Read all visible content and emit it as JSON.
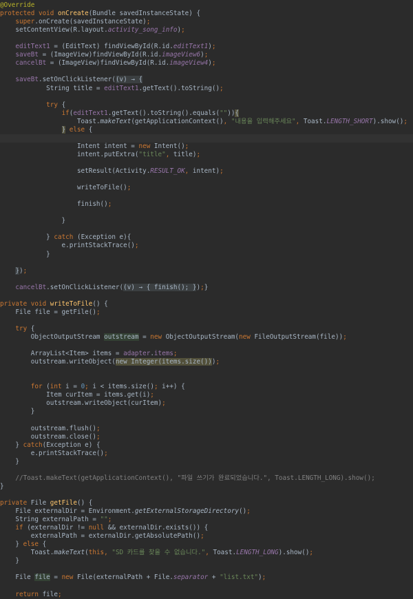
{
  "editor": {
    "language": "java",
    "lines": [
      [
        [
          "ann",
          "@Override"
        ]
      ],
      [
        [
          "kw",
          "protected void "
        ],
        [
          "fn",
          "onCreate"
        ],
        [
          "p",
          "(Bundle savedInstanceState) {"
        ]
      ],
      [
        [
          "p",
          "    "
        ],
        [
          "kw",
          "super"
        ],
        [
          "p",
          ".onCreate(savedInstanceState)"
        ],
        [
          "kw",
          ";"
        ]
      ],
      [
        [
          "p",
          "    setContentView(R.layout."
        ],
        [
          "fldi",
          "activity_song_info"
        ],
        [
          "p",
          ")"
        ],
        [
          "kw",
          ";"
        ]
      ],
      [
        [
          "p",
          ""
        ]
      ],
      [
        [
          "p",
          "    "
        ],
        [
          "fld",
          "editText1"
        ],
        [
          "p",
          " = (EditText) findViewById(R.id."
        ],
        [
          "fldi",
          "editText1"
        ],
        [
          "p",
          ")"
        ],
        [
          "kw",
          ";"
        ]
      ],
      [
        [
          "p",
          "    "
        ],
        [
          "fld",
          "saveBt"
        ],
        [
          "p",
          " = (ImageView)findViewById(R.id."
        ],
        [
          "fldi",
          "imageView6"
        ],
        [
          "p",
          ")"
        ],
        [
          "kw",
          ";"
        ]
      ],
      [
        [
          "p",
          "    "
        ],
        [
          "fld",
          "cancelBt"
        ],
        [
          "p",
          " = (ImageView)findViewById(R.id."
        ],
        [
          "fldi",
          "imageView4"
        ],
        [
          "p",
          ")"
        ],
        [
          "kw",
          ";"
        ]
      ],
      [
        [
          "p",
          ""
        ]
      ],
      [
        [
          "p",
          "    "
        ],
        [
          "fld",
          "saveBt"
        ],
        [
          "p",
          ".setOnClickListener("
        ],
        [
          "lam",
          "(v) → {"
        ]
      ],
      [
        [
          "p",
          "            String title = "
        ],
        [
          "fld",
          "editText1"
        ],
        [
          "p",
          ".getText().toString()"
        ],
        [
          "kw",
          ";"
        ]
      ],
      [
        [
          "p",
          ""
        ]
      ],
      [
        [
          "p",
          "            "
        ],
        [
          "kw",
          "try "
        ],
        [
          "p",
          "{"
        ]
      ],
      [
        [
          "p",
          "                "
        ],
        [
          "kw",
          "if"
        ],
        [
          "p",
          "("
        ],
        [
          "fld",
          "editText1"
        ],
        [
          "p",
          ".getText().toString().equals("
        ],
        [
          "str",
          "\"\""
        ],
        [
          "p",
          "))"
        ],
        [
          "hl2",
          "{"
        ]
      ],
      [
        [
          "p",
          "                    Toast."
        ],
        [
          "ital",
          "makeText"
        ],
        [
          "p",
          "(getApplicationContext()"
        ],
        [
          "kw",
          ", "
        ],
        [
          "str",
          "\"내용을 입력해주세요\""
        ],
        [
          "kw",
          ", "
        ],
        [
          "p",
          "Toast."
        ],
        [
          "fldi",
          "LENGTH_SHORT"
        ],
        [
          "p",
          ").show()"
        ],
        [
          "kw",
          ";"
        ]
      ],
      [
        [
          "p",
          "                "
        ],
        [
          "hl2",
          "}"
        ],
        [
          "kw",
          " else "
        ],
        [
          "p",
          "{"
        ]
      ],
      [
        [
          "p",
          ""
        ]
      ],
      [
        [
          "p",
          "                    Intent intent = "
        ],
        [
          "kw",
          "new "
        ],
        [
          "p",
          "Intent()"
        ],
        [
          "kw",
          ";"
        ]
      ],
      [
        [
          "p",
          "                    intent.putExtra("
        ],
        [
          "str",
          "\"title\""
        ],
        [
          "kw",
          ", "
        ],
        [
          "p",
          "title)"
        ],
        [
          "kw",
          ";"
        ]
      ],
      [
        [
          "p",
          ""
        ]
      ],
      [
        [
          "p",
          "                    setResult(Activity."
        ],
        [
          "fldi",
          "RESULT_OK"
        ],
        [
          "kw",
          ", "
        ],
        [
          "p",
          "intent)"
        ],
        [
          "kw",
          ";"
        ]
      ],
      [
        [
          "p",
          ""
        ]
      ],
      [
        [
          "p",
          "                    writeToFile()"
        ],
        [
          "kw",
          ";"
        ]
      ],
      [
        [
          "p",
          ""
        ]
      ],
      [
        [
          "p",
          "                    finish()"
        ],
        [
          "kw",
          ";"
        ]
      ],
      [
        [
          "p",
          ""
        ]
      ],
      [
        [
          "p",
          "                }"
        ]
      ],
      [
        [
          "p",
          ""
        ]
      ],
      [
        [
          "p",
          "            } "
        ],
        [
          "kw",
          "catch "
        ],
        [
          "p",
          "(Exception e){"
        ]
      ],
      [
        [
          "p",
          "                e.printStackTrace()"
        ],
        [
          "kw",
          ";"
        ]
      ],
      [
        [
          "p",
          "            }"
        ]
      ],
      [
        [
          "p",
          ""
        ]
      ],
      [
        [
          "p",
          "    "
        ],
        [
          "lam",
          "}"
        ],
        [
          "p",
          ")"
        ],
        [
          "kw",
          ";"
        ]
      ],
      [
        [
          "p",
          ""
        ]
      ],
      [
        [
          "p",
          "    "
        ],
        [
          "fld",
          "cancelBt"
        ],
        [
          "p",
          ".setOnClickListener("
        ],
        [
          "lam",
          "(v) → { finish(); }"
        ],
        [
          "p",
          ")"
        ],
        [
          "kw",
          ";"
        ],
        [
          "p",
          "}"
        ]
      ],
      [
        [
          "p",
          ""
        ]
      ],
      [
        [
          "kw",
          "private void "
        ],
        [
          "fn",
          "writeToFile"
        ],
        [
          "p",
          "() {"
        ]
      ],
      [
        [
          "p",
          "    File file = getFile()"
        ],
        [
          "kw",
          ";"
        ]
      ],
      [
        [
          "p",
          ""
        ]
      ],
      [
        [
          "p",
          "    "
        ],
        [
          "kw",
          "try "
        ],
        [
          "p",
          "{"
        ]
      ],
      [
        [
          "p",
          "        ObjectOutputStream "
        ],
        [
          "hl",
          "outstream"
        ],
        [
          "p",
          " = "
        ],
        [
          "kw",
          "new "
        ],
        [
          "p",
          "ObjectOutputStream("
        ],
        [
          "kw",
          "new "
        ],
        [
          "p",
          "FileOutputStream(file))"
        ],
        [
          "kw",
          ";"
        ]
      ],
      [
        [
          "p",
          ""
        ]
      ],
      [
        [
          "p",
          "        ArrayList<Item> items = "
        ],
        [
          "fld",
          "adapter"
        ],
        [
          "p",
          "."
        ],
        [
          "fld",
          "items"
        ],
        [
          "kw",
          ";"
        ]
      ],
      [
        [
          "p",
          "        outstream.writeObject("
        ],
        [
          "hl2",
          "new Integer(items.size())"
        ],
        [
          "p",
          ")"
        ],
        [
          "kw",
          ";"
        ]
      ],
      [
        [
          "p",
          ""
        ]
      ],
      [
        [
          "p",
          ""
        ]
      ],
      [
        [
          "p",
          "        "
        ],
        [
          "kw",
          "for "
        ],
        [
          "p",
          "("
        ],
        [
          "kw",
          "int "
        ],
        [
          "p",
          "i = "
        ],
        [
          "num",
          "0"
        ],
        [
          "kw",
          "; "
        ],
        [
          "p",
          "i < items.size()"
        ],
        [
          "kw",
          "; "
        ],
        [
          "p",
          "i++) {"
        ]
      ],
      [
        [
          "p",
          "            Item curItem = items.get(i)"
        ],
        [
          "kw",
          ";"
        ]
      ],
      [
        [
          "p",
          "            outstream.writeObject(curItem)"
        ],
        [
          "kw",
          ";"
        ]
      ],
      [
        [
          "p",
          "        }"
        ]
      ],
      [
        [
          "p",
          ""
        ]
      ],
      [
        [
          "p",
          "        outstream.flush()"
        ],
        [
          "kw",
          ";"
        ]
      ],
      [
        [
          "p",
          "        outstream.close()"
        ],
        [
          "kw",
          ";"
        ]
      ],
      [
        [
          "p",
          "    } "
        ],
        [
          "kw",
          "catch"
        ],
        [
          "p",
          "(Exception e) {"
        ]
      ],
      [
        [
          "p",
          "        e.printStackTrace()"
        ],
        [
          "kw",
          ";"
        ]
      ],
      [
        [
          "p",
          "    }"
        ]
      ],
      [
        [
          "p",
          ""
        ]
      ],
      [
        [
          "cmt",
          "    //Toast.makeText(getApplicationContext(), \"파일 쓰기가 완료되었습니다.\", Toast.LENGTH_LONG).show();"
        ]
      ],
      [
        [
          "p",
          "}"
        ]
      ],
      [
        [
          "p",
          ""
        ]
      ],
      [
        [
          "kw",
          "private "
        ],
        [
          "p",
          "File "
        ],
        [
          "fn",
          "getFile"
        ],
        [
          "p",
          "() {"
        ]
      ],
      [
        [
          "p",
          "    File externalDir = Environment."
        ],
        [
          "ital",
          "getExternalStorageDirectory"
        ],
        [
          "p",
          "()"
        ],
        [
          "kw",
          ";"
        ]
      ],
      [
        [
          "p",
          "    String externalPath = "
        ],
        [
          "str",
          "\"\""
        ],
        [
          "kw",
          ";"
        ]
      ],
      [
        [
          "p",
          "    "
        ],
        [
          "kw",
          "if "
        ],
        [
          "p",
          "(externalDir != "
        ],
        [
          "kw",
          "null "
        ],
        [
          "p",
          "&& externalDir.exists()) {"
        ]
      ],
      [
        [
          "p",
          "        externalPath = externalDir.getAbsolutePath()"
        ],
        [
          "kw",
          ";"
        ]
      ],
      [
        [
          "p",
          "    } "
        ],
        [
          "kw",
          "else "
        ],
        [
          "p",
          "{"
        ]
      ],
      [
        [
          "p",
          "        Toast."
        ],
        [
          "ital",
          "makeText"
        ],
        [
          "p",
          "("
        ],
        [
          "kw",
          "this, "
        ],
        [
          "str",
          "\"SD 카드를 찾을 수 없습니다.\""
        ],
        [
          "kw",
          ", "
        ],
        [
          "p",
          "Toast."
        ],
        [
          "fldi",
          "LENGTH_LONG"
        ],
        [
          "p",
          ").show()"
        ],
        [
          "kw",
          ";"
        ]
      ],
      [
        [
          "p",
          "    }"
        ]
      ],
      [
        [
          "p",
          ""
        ]
      ],
      [
        [
          "p",
          "    File "
        ],
        [
          "hl",
          "file"
        ],
        [
          "p",
          " = "
        ],
        [
          "kw",
          "new "
        ],
        [
          "p",
          "File(externalPath + File."
        ],
        [
          "fldi",
          "separator"
        ],
        [
          "p",
          " + "
        ],
        [
          "str",
          "\"list.txt\""
        ],
        [
          "p",
          ")"
        ],
        [
          "kw",
          ";"
        ]
      ],
      [
        [
          "p",
          ""
        ]
      ],
      [
        [
          "p",
          "    "
        ],
        [
          "kw",
          "return "
        ],
        [
          "p",
          "file"
        ],
        [
          "kw",
          ";"
        ]
      ]
    ]
  }
}
